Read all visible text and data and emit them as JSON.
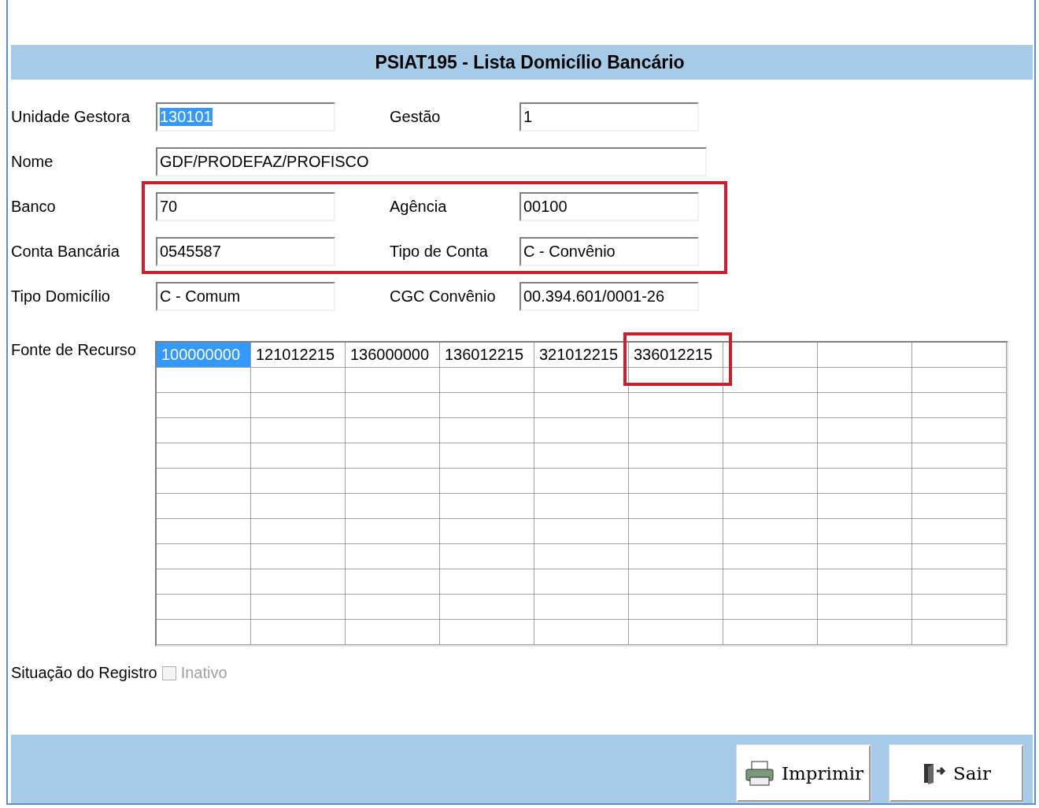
{
  "title": "PSIAT195 - Lista Domicílio Bancário",
  "rows": [
    {
      "fields": [
        {
          "label": "Unidade Gestora",
          "value": "130101",
          "text_selected": true
        },
        {
          "label": "Gestão",
          "value": "1",
          "text_selected": false
        }
      ]
    },
    {
      "fields": [
        {
          "label": "Nome",
          "value": "GDF/PRODEFAZ/PROFISCO",
          "text_selected": false
        }
      ]
    },
    {
      "fields": [
        {
          "label": "Banco",
          "value": "70",
          "text_selected": false
        },
        {
          "label": "Agência",
          "value": "00100",
          "text_selected": false
        }
      ]
    },
    {
      "fields": [
        {
          "label": "Conta Bancária",
          "value": "0545587",
          "text_selected": false
        },
        {
          "label": "Tipo de Conta",
          "value": "C - Convênio",
          "text_selected": false
        }
      ]
    },
    {
      "fields": [
        {
          "label": "Tipo Domicílio",
          "value": "C - Comum",
          "text_selected": false
        },
        {
          "label": "CGC Convênio",
          "value": "00.394.601/0001-26",
          "text_selected": false
        }
      ]
    }
  ],
  "fonte": {
    "label": "Fonte de Recurso",
    "cells": [
      {
        "value": "100000000",
        "selected": true
      },
      {
        "value": "121012215",
        "selected": false
      },
      {
        "value": "136000000",
        "selected": false
      },
      {
        "value": "136012215",
        "selected": false
      },
      {
        "value": "321012215",
        "selected": false
      },
      {
        "value": "336012215",
        "selected": false
      }
    ]
  },
  "situacao": {
    "label": "Situação do Registro",
    "checkbox_label": "Inativo",
    "checked": false,
    "disabled": true
  },
  "buttons": [
    {
      "kind": "print",
      "label": "Imprimir"
    },
    {
      "kind": "exit",
      "label": "Sair"
    }
  ]
}
